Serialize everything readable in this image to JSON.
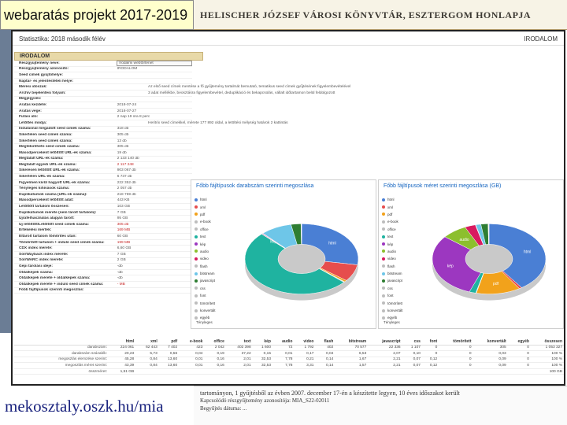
{
  "slide": {
    "title": "webaratás projekt 2017-2019",
    "url": "mekosztaly.oszk.hu/mia"
  },
  "background": {
    "site_title": "HELISCHER JÓZSEF VÁROSI KÖNYVTÁR, ESZTERGOM HONLAPJA",
    "bottom_line1": "tartományon, 1 gyűjtésből az évben 2007. december 17-én a készítette legyen, 10 éves időszakot került",
    "bottom_line2": "Kapcsolódó részgyűjtemény azonosítója: MIA_S22-02011",
    "bottom_line3": "Begyűjtés dátuma: ..."
  },
  "window": {
    "header_left": "Statisztika: 2018 második félév",
    "header_right": "IRODALOM",
    "section": "IRODALOM",
    "rows": [
      {
        "k": "Részgyűjtemény neve:",
        "v": "Irodalmi webtörténet",
        "style": "boxed"
      },
      {
        "k": "Részgyűjtemény azonosító:",
        "v": "IRODALOM",
        "style": ""
      },
      {
        "k": "Seed címek gyűjtőhelye:",
        "v": "",
        "style": ""
      },
      {
        "k": "Naptár- és jelentéstételi helye:",
        "v": "",
        "style": ""
      },
      {
        "k": "Mérési időszak:",
        "v": "",
        "long": "Az első seed címek mentése a fő gyűjtemény tartalmát bemutató, tematikus seed címek gyűjtésének figyelembevételével",
        "style": ""
      },
      {
        "k": "Archív bejelentési folyam:",
        "v": "",
        "long": "3 adat mellékbe, beosztásra figyelembevétel, deduplikáció és bekapcsolás, vállalt időtartamon belül feldolgozott",
        "style": ""
      },
      {
        "k": "Megjegyzés:",
        "v": "",
        "style": ""
      },
      {
        "k": "Aratás kezdete:",
        "v": "2018-07-24",
        "style": ""
      },
      {
        "k": "Aratás vége:",
        "v": "2018-07-27",
        "style": ""
      },
      {
        "k": "Futási idő:",
        "v": "2 nap 19 óra 8 perc",
        "style": ""
      },
      {
        "k": "Letöltés módja:",
        "v": "",
        "long": "Heritrix seed címekkel, mérete 177 892 oldal, a letöltési mélység határok 2 kattintás",
        "style": ""
      },
      {
        "k": "Indulásnál megadott seed címek száma:",
        "v": "318 db",
        "style": ""
      },
      {
        "k": "Sikertelen seed címek száma:",
        "v": "305 db",
        "style": ""
      },
      {
        "k": "Sikertelen seed címek száma:",
        "v": "13 db",
        "style": ""
      },
      {
        "k": "Megtekinthető seed címek száma:",
        "v": "305 db",
        "style": ""
      },
      {
        "k": "Másodperceként letöltött URL-ek száma:",
        "v": "19 db",
        "style": ""
      },
      {
        "k": "Megtalált URL-ek száma:",
        "v": "2 133 140 db",
        "style": ""
      },
      {
        "k": "Megtalált egyedi URL-ek száma:",
        "v": "2 117 248",
        "style": "red"
      },
      {
        "k": "Sikeresen letöltött URL-ek száma:",
        "v": "903 067 db",
        "style": ""
      },
      {
        "k": "Sikertelen URL-ek száma:",
        "v": "6 737 db",
        "style": ""
      },
      {
        "k": "Figyelmen kívül hagyott URL-ek száma:",
        "v": "222 352 db",
        "style": ""
      },
      {
        "k": "Tényleges kihívások száma:",
        "v": "2 057 db",
        "style": ""
      },
      {
        "k": "Duplikátumok száma (URL-ek száma):",
        "v": "218 769 db",
        "style": ""
      },
      {
        "k": "Másodperceként letöltött adat:",
        "v": "443 KB",
        "style": ""
      },
      {
        "k": "Letöltött tartalom összesen:",
        "v": "103 GB",
        "style": ""
      },
      {
        "k": "Duplikátumok mérete (nem tárolt tartalom):",
        "v": "7 GB",
        "style": ""
      },
      {
        "k": "Újrafelhasználás alapján tárolt:",
        "v": "95 GB",
        "style": ""
      },
      {
        "k": "Új letöltött/Letöltött seed címek száma:",
        "v": "305 db",
        "style": "red"
      },
      {
        "k": "Értékelési mérték:",
        "v": "169 MB",
        "style": "red"
      },
      {
        "k": "Eltárolt tartalom tömörítés után:",
        "v": "60 GB",
        "style": ""
      },
      {
        "k": "Tömörített tartalom + induló seed címek száma:",
        "v": "199 MB",
        "style": "red"
      },
      {
        "k": "CDX index mérete:",
        "v": "6,60 GB",
        "style": ""
      },
      {
        "k": "SolrWayback index mérete:",
        "v": "7 GB",
        "style": ""
      },
      {
        "k": "SolrWARC index mérete:",
        "v": "2 GB",
        "style": ""
      },
      {
        "k": "Gépi tárolási ideje:",
        "v": "-db",
        "style": ""
      },
      {
        "k": "Oldalképek száma:",
        "v": "-db",
        "style": ""
      },
      {
        "k": "Oldalképek mérete + oldalképek száma:",
        "v": "-db",
        "style": ""
      },
      {
        "k": "Oldalképek mérete + induló seed címek száma:",
        "v": "- MB",
        "style": "red"
      },
      {
        "k": "Főbb fájltípusok szerinti megoszlás:",
        "v": "",
        "style": ""
      }
    ],
    "table": {
      "headers": [
        "",
        "html",
        "xml",
        "pdf",
        "e-book",
        "office",
        "text",
        "kép",
        "audio",
        "video",
        "flash",
        "bitstream",
        "javascript",
        "css",
        "font",
        "tömörített",
        "konvertált",
        "egyéb",
        "összesen"
      ],
      "rows": [
        [
          "darabszám:",
          "224 061",
          "62 443",
          "7 402",
          "423",
          "2 042",
          "402 398",
          "1 600",
          "72",
          "1 792",
          "402",
          "70 577",
          "22 336",
          "1 107",
          "0",
          "0",
          "305",
          "0",
          "1 053 327"
        ],
        [
          "darabszám százalék:",
          "20,23",
          "5,73",
          "0,56",
          "0,04",
          "0,19",
          "37,22",
          "0,15",
          "0,01",
          "0,17",
          "0,04",
          "6,53",
          "2,07",
          "0,10",
          "0",
          "0",
          "0,03",
          "0",
          "100 %"
        ],
        [
          "megoszlás elemzése szerint:",
          "45,28",
          "0,84",
          "13,60",
          "0,01",
          "0,16",
          "2,01",
          "32,53",
          "7,78",
          "0,21",
          "0,14",
          "1,67",
          "2,21",
          "0,07",
          "0,12",
          "0",
          "0,09",
          "0",
          "100 %"
        ],
        [
          "megoszlás méret szerint:",
          "43,39",
          "0,84",
          "13,60",
          "0,01",
          "0,16",
          "2,01",
          "32,53",
          "7,78",
          "3,31",
          "0,14",
          "1,57",
          "2,21",
          "0,07",
          "0,12",
          "0",
          "0,09",
          "0",
          "100 %"
        ],
        [
          "összméret:",
          "1,51 GB",
          "",
          "",
          "",
          "",
          "",
          "",
          "",
          "",
          "",
          "",
          "",
          "",
          "",
          "",
          "",
          "",
          "100 GB"
        ]
      ]
    }
  },
  "chart_data": [
    {
      "type": "pie",
      "title": "Főbb fájltípusok darabszám szerinti megoszlása",
      "categories": [
        "html",
        "xml",
        "pdf",
        "e-book",
        "office",
        "text",
        "kép",
        "audio",
        "video",
        "flash",
        "bitstream",
        "javascript",
        "css",
        "font",
        "tömörített",
        "konvertált",
        "egyéb"
      ],
      "values": [
        20.23,
        5.73,
        0.56,
        0.04,
        0.19,
        37.22,
        0.15,
        0.01,
        0.17,
        0.04,
        6.53,
        2.07,
        0.1,
        0,
        0,
        0.03,
        0
      ],
      "slice_labels": {
        "kép": "kép",
        "html": "html"
      },
      "foot": "Tényleges"
    },
    {
      "type": "pie",
      "title": "Főbb fájltípusok méret szerinti megoszlása (GB)",
      "categories": [
        "html",
        "xml",
        "pdf",
        "e-book",
        "office",
        "text",
        "kép",
        "audio",
        "video",
        "flash",
        "bitstream",
        "javascript",
        "css",
        "font",
        "tömörített",
        "konvertált",
        "egyéb"
      ],
      "values": [
        43.39,
        0.84,
        13.6,
        0.01,
        0.16,
        2.01,
        32.53,
        7.78,
        3.31,
        0.14,
        1.57,
        2.21,
        0.07,
        0.12,
        0,
        0.09,
        0
      ],
      "slice_labels": {
        "audio": "audio",
        "html": "html",
        "kép": "kép",
        "pdf": "pdf"
      },
      "foot": "Tényleges"
    }
  ],
  "colors": {
    "html": "#4a7fd4",
    "kép": "#9c37c0",
    "pdf": "#f2a21b",
    "audio": "#8cbf2e",
    "text": "#1fb3a0",
    "bitstream": "#6ec6e8",
    "xml": "#e64d4d",
    "javascript": "#2e7d32",
    "video": "#d81b60",
    "other": "#bdbdbd"
  }
}
